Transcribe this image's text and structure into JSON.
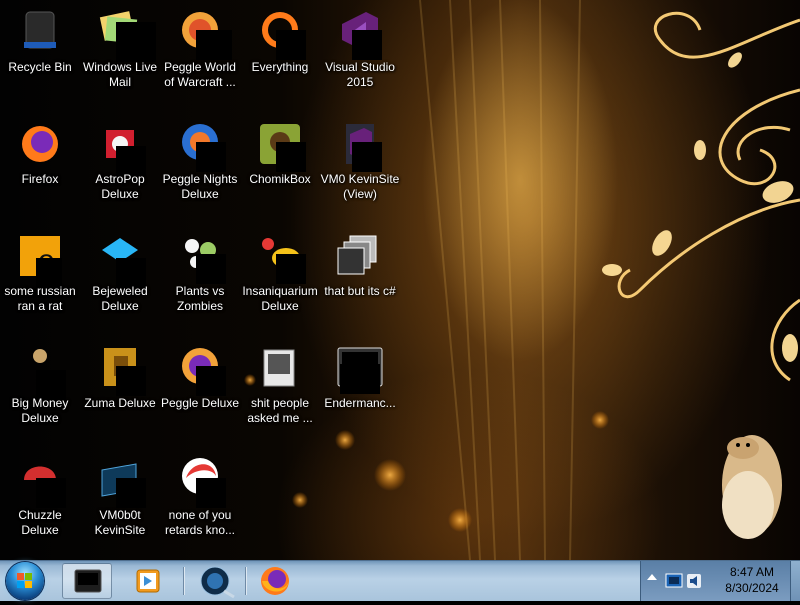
{
  "desktop": {
    "icons": [
      {
        "label": "Recycle Bin",
        "icon": "recycle-bin-icon"
      },
      {
        "label": "Windows Live Mail",
        "icon": "mail-icon"
      },
      {
        "label": "Peggle World of Warcraft ...",
        "icon": "peggle-icon"
      },
      {
        "label": "Everything",
        "icon": "search-icon"
      },
      {
        "label": "Visual Studio 2015",
        "icon": "visual-studio-icon"
      },
      {
        "label": "Firefox",
        "icon": "firefox-icon"
      },
      {
        "label": "AstroPop Deluxe",
        "icon": "astropop-icon"
      },
      {
        "label": "Peggle Nights Deluxe",
        "icon": "peggle-nights-icon"
      },
      {
        "label": "ChomikBox",
        "icon": "chomikbox-icon"
      },
      {
        "label": "VM0 KevinSite (View)",
        "icon": "visual-studio-solution-icon"
      },
      {
        "label": "some russian ran a rat",
        "icon": "executable-icon"
      },
      {
        "label": "Bejeweled Deluxe",
        "icon": "bejeweled-icon"
      },
      {
        "label": "Plants vs Zombies",
        "icon": "plants-vs-zombies-icon"
      },
      {
        "label": "Insaniquarium Deluxe",
        "icon": "insaniquarium-icon"
      },
      {
        "label": "that but its c#",
        "icon": "shortcut-icon"
      },
      {
        "label": "Big Money Deluxe",
        "icon": "big-money-icon"
      },
      {
        "label": "Zuma Deluxe",
        "icon": "zuma-icon"
      },
      {
        "label": "Peggle Deluxe",
        "icon": "peggle-deluxe-icon"
      },
      {
        "label": "shit people asked me ...",
        "icon": "folder-icon"
      },
      {
        "label": "Endermanc...",
        "icon": "terminal-icon"
      },
      {
        "label": "Chuzzle Deluxe",
        "icon": "chuzzle-icon"
      },
      {
        "label": "VM0b0t KevinSite",
        "icon": "vm-shortcut-icon"
      },
      {
        "label": "none of you retards kno...",
        "icon": "app-icon"
      }
    ]
  },
  "taskbar": {
    "clock_time": "8:47 AM",
    "clock_date": "8/30/2024",
    "pinned": [
      {
        "name": "terminal",
        "icon": "terminal-icon"
      },
      {
        "name": "media-player",
        "icon": "media-player-icon"
      },
      {
        "name": "network",
        "icon": "network-icon"
      },
      {
        "name": "firefox",
        "icon": "firefox-icon"
      }
    ]
  },
  "colors": {
    "taskbar_top": "#6f95b8",
    "taskbar_bottom": "#a9c4dc",
    "wallpaper_accent": "#f5b040"
  }
}
